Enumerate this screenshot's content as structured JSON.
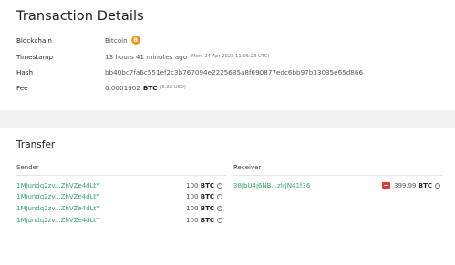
{
  "header": {
    "title": "Transaction Details"
  },
  "details": {
    "blockchain": {
      "label": "Blockchain",
      "value": "Bitcoin",
      "icon": "bitcoin-icon",
      "icon_color": "#f7931a"
    },
    "timestamp": {
      "label": "Timestamp",
      "value": "13 hours 41 minutes ago",
      "extra": "(Mon, 24 Apr 2023 11:05:23 UTC)"
    },
    "hash": {
      "label": "Hash",
      "value": "bb40bc7fa6c551ef2c3b767094e2225685a8f690877edc6bb97b33035e65d866"
    },
    "fee": {
      "label": "Fee",
      "amount": "0.0001902",
      "unit": "BTC",
      "usd": "(5.22 USD)"
    }
  },
  "transfer": {
    "title": "Transfer",
    "sender_label": "Sender",
    "receiver_label": "Receiver",
    "senders": [
      {
        "address": "1Mjundq2zv...ZhVZe4dLtY",
        "amount": "100",
        "unit": "BTC"
      },
      {
        "address": "1Mjundq2zv...ZhVZe4dLtY",
        "amount": "100",
        "unit": "BTC"
      },
      {
        "address": "1Mjundq2zv...ZhVZe4dLtY",
        "amount": "100",
        "unit": "BTC"
      },
      {
        "address": "1Mjundq2zv...ZhVZe4dLtY",
        "amount": "100",
        "unit": "BTC"
      }
    ],
    "receivers": [
      {
        "address": "38JbU4j6NB...zIrJN41f36",
        "amount": "399.99",
        "unit": "BTC"
      }
    ]
  },
  "colors": {
    "link": "#33a86a",
    "band": "#f2f2f2",
    "alert": "#e53935"
  }
}
